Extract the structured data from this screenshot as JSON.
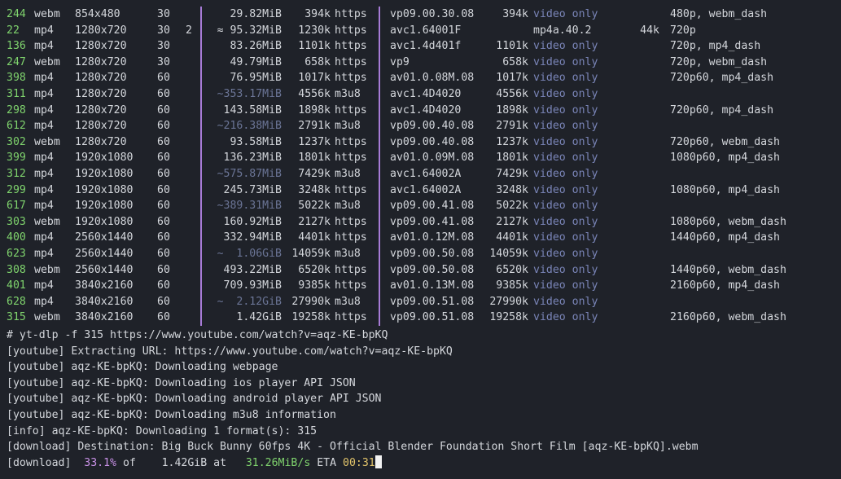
{
  "formats": [
    {
      "id": "244",
      "ext": "webm",
      "res": "854x480",
      "fps": "30",
      "ch": "",
      "size": "29.82MiB",
      "approx": false,
      "tbr": "394k",
      "proto": "https",
      "vcodec": "vp09.00.30.08",
      "vbr": "394k",
      "acodec": "video only",
      "abr": "",
      "more": "480p, webm_dash"
    },
    {
      "id": "22",
      "ext": "mp4",
      "res": "1280x720",
      "fps": "30",
      "ch": "2",
      "size": "≈ 95.32MiB",
      "approx": false,
      "tbr": "1230k",
      "proto": "https",
      "vcodec": "avc1.64001F",
      "vbr": "",
      "acodec": "mp4a.40.2",
      "abr": "44k",
      "more": "720p"
    },
    {
      "id": "136",
      "ext": "mp4",
      "res": "1280x720",
      "fps": "30",
      "ch": "",
      "size": "83.26MiB",
      "approx": false,
      "tbr": "1101k",
      "proto": "https",
      "vcodec": "avc1.4d401f",
      "vbr": "1101k",
      "acodec": "video only",
      "abr": "",
      "more": "720p, mp4_dash"
    },
    {
      "id": "247",
      "ext": "webm",
      "res": "1280x720",
      "fps": "30",
      "ch": "",
      "size": "49.79MiB",
      "approx": false,
      "tbr": "658k",
      "proto": "https",
      "vcodec": "vp9",
      "vbr": "658k",
      "acodec": "video only",
      "abr": "",
      "more": "720p, webm_dash"
    },
    {
      "id": "398",
      "ext": "mp4",
      "res": "1280x720",
      "fps": "60",
      "ch": "",
      "size": "76.95MiB",
      "approx": false,
      "tbr": "1017k",
      "proto": "https",
      "vcodec": "av01.0.08M.08",
      "vbr": "1017k",
      "acodec": "video only",
      "abr": "",
      "more": "720p60, mp4_dash"
    },
    {
      "id": "311",
      "ext": "mp4",
      "res": "1280x720",
      "fps": "60",
      "ch": "",
      "size": "~353.17MiB",
      "approx": true,
      "tbr": "4556k",
      "proto": "m3u8",
      "vcodec": "avc1.4D4020",
      "vbr": "4556k",
      "acodec": "video only",
      "abr": "",
      "more": ""
    },
    {
      "id": "298",
      "ext": "mp4",
      "res": "1280x720",
      "fps": "60",
      "ch": "",
      "size": "143.58MiB",
      "approx": false,
      "tbr": "1898k",
      "proto": "https",
      "vcodec": "avc1.4D4020",
      "vbr": "1898k",
      "acodec": "video only",
      "abr": "",
      "more": "720p60, mp4_dash"
    },
    {
      "id": "612",
      "ext": "mp4",
      "res": "1280x720",
      "fps": "60",
      "ch": "",
      "size": "~216.38MiB",
      "approx": true,
      "tbr": "2791k",
      "proto": "m3u8",
      "vcodec": "vp09.00.40.08",
      "vbr": "2791k",
      "acodec": "video only",
      "abr": "",
      "more": ""
    },
    {
      "id": "302",
      "ext": "webm",
      "res": "1280x720",
      "fps": "60",
      "ch": "",
      "size": "93.58MiB",
      "approx": false,
      "tbr": "1237k",
      "proto": "https",
      "vcodec": "vp09.00.40.08",
      "vbr": "1237k",
      "acodec": "video only",
      "abr": "",
      "more": "720p60, webm_dash"
    },
    {
      "id": "399",
      "ext": "mp4",
      "res": "1920x1080",
      "fps": "60",
      "ch": "",
      "size": "136.23MiB",
      "approx": false,
      "tbr": "1801k",
      "proto": "https",
      "vcodec": "av01.0.09M.08",
      "vbr": "1801k",
      "acodec": "video only",
      "abr": "",
      "more": "1080p60, mp4_dash"
    },
    {
      "id": "312",
      "ext": "mp4",
      "res": "1920x1080",
      "fps": "60",
      "ch": "",
      "size": "~575.87MiB",
      "approx": true,
      "tbr": "7429k",
      "proto": "m3u8",
      "vcodec": "avc1.64002A",
      "vbr": "7429k",
      "acodec": "video only",
      "abr": "",
      "more": ""
    },
    {
      "id": "299",
      "ext": "mp4",
      "res": "1920x1080",
      "fps": "60",
      "ch": "",
      "size": "245.73MiB",
      "approx": false,
      "tbr": "3248k",
      "proto": "https",
      "vcodec": "avc1.64002A",
      "vbr": "3248k",
      "acodec": "video only",
      "abr": "",
      "more": "1080p60, mp4_dash"
    },
    {
      "id": "617",
      "ext": "mp4",
      "res": "1920x1080",
      "fps": "60",
      "ch": "",
      "size": "~389.31MiB",
      "approx": true,
      "tbr": "5022k",
      "proto": "m3u8",
      "vcodec": "vp09.00.41.08",
      "vbr": "5022k",
      "acodec": "video only",
      "abr": "",
      "more": ""
    },
    {
      "id": "303",
      "ext": "webm",
      "res": "1920x1080",
      "fps": "60",
      "ch": "",
      "size": "160.92MiB",
      "approx": false,
      "tbr": "2127k",
      "proto": "https",
      "vcodec": "vp09.00.41.08",
      "vbr": "2127k",
      "acodec": "video only",
      "abr": "",
      "more": "1080p60, webm_dash"
    },
    {
      "id": "400",
      "ext": "mp4",
      "res": "2560x1440",
      "fps": "60",
      "ch": "",
      "size": "332.94MiB",
      "approx": false,
      "tbr": "4401k",
      "proto": "https",
      "vcodec": "av01.0.12M.08",
      "vbr": "4401k",
      "acodec": "video only",
      "abr": "",
      "more": "1440p60, mp4_dash"
    },
    {
      "id": "623",
      "ext": "mp4",
      "res": "2560x1440",
      "fps": "60",
      "ch": "",
      "size": "~  1.06GiB",
      "approx": true,
      "tbr": "14059k",
      "proto": "m3u8",
      "vcodec": "vp09.00.50.08",
      "vbr": "14059k",
      "acodec": "video only",
      "abr": "",
      "more": ""
    },
    {
      "id": "308",
      "ext": "webm",
      "res": "2560x1440",
      "fps": "60",
      "ch": "",
      "size": "493.22MiB",
      "approx": false,
      "tbr": "6520k",
      "proto": "https",
      "vcodec": "vp09.00.50.08",
      "vbr": "6520k",
      "acodec": "video only",
      "abr": "",
      "more": "1440p60, webm_dash"
    },
    {
      "id": "401",
      "ext": "mp4",
      "res": "3840x2160",
      "fps": "60",
      "ch": "",
      "size": "709.93MiB",
      "approx": false,
      "tbr": "9385k",
      "proto": "https",
      "vcodec": "av01.0.13M.08",
      "vbr": "9385k",
      "acodec": "video only",
      "abr": "",
      "more": "2160p60, mp4_dash"
    },
    {
      "id": "628",
      "ext": "mp4",
      "res": "3840x2160",
      "fps": "60",
      "ch": "",
      "size": "~  2.12GiB",
      "approx": true,
      "tbr": "27990k",
      "proto": "m3u8",
      "vcodec": "vp09.00.51.08",
      "vbr": "27990k",
      "acodec": "video only",
      "abr": "",
      "more": ""
    },
    {
      "id": "315",
      "ext": "webm",
      "res": "3840x2160",
      "fps": "60",
      "ch": "",
      "size": "1.42GiB",
      "approx": false,
      "tbr": "19258k",
      "proto": "https",
      "vcodec": "vp09.00.51.08",
      "vbr": "19258k",
      "acodec": "video only",
      "abr": "",
      "more": "2160p60, webm_dash"
    }
  ],
  "log": [
    "# yt-dlp -f 315 https://www.youtube.com/watch?v=aqz-KE-bpKQ",
    "[youtube] Extracting URL: https://www.youtube.com/watch?v=aqz-KE-bpKQ",
    "[youtube] aqz-KE-bpKQ: Downloading webpage",
    "[youtube] aqz-KE-bpKQ: Downloading ios player API JSON",
    "[youtube] aqz-KE-bpKQ: Downloading android player API JSON",
    "[youtube] aqz-KE-bpKQ: Downloading m3u8 information",
    "[info] aqz-KE-bpKQ: Downloading 1 format(s): 315",
    "[download] Destination: Big Buck Bunny 60fps 4K - Official Blender Foundation Short Film [aqz-KE-bpKQ].webm"
  ],
  "progress": {
    "prefix": "[download]",
    "percent": "33.1%",
    "of": "of",
    "total": "1.42GiB",
    "at": "at",
    "speed": "31.26MiB/s",
    "eta_label": "ETA",
    "eta": "00:31"
  },
  "colors": {
    "background": "#1f2229",
    "text": "#d4d7dc",
    "format_id": "#7fd36d",
    "separator": "#a77bd6",
    "video_only": "#7a85b8",
    "percent": "#c891e6",
    "speed": "#7fd36d",
    "eta": "#e1c36a"
  }
}
